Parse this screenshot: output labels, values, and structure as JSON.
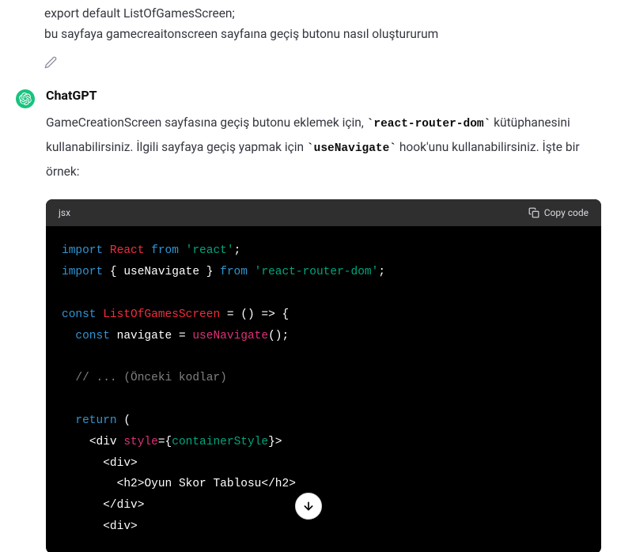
{
  "user": {
    "line1": "export default ListOfGamesScreen;",
    "line2": "bu sayfaya gamecreaitonscreen sayfaına geçiş butonu nasıl oluştururum"
  },
  "assistant": {
    "name": "ChatGPT",
    "p1_t1": "GameCreationScreen sayfasına geçiş butonu eklemek için, ",
    "p1_c1": "`react-router-dom`",
    "p1_t2": " kütüphanesini kullanabilirsiniz. İlgili sayfaya geçiş yapmak için ",
    "p1_c2": "`useNavigate`",
    "p1_t3": " hook'unu kullanabilirsiniz. İşte bir örnek:"
  },
  "codeblock": {
    "lang": "jsx",
    "copy_label": "Copy code",
    "lines": {
      "l1": {
        "import": "import",
        "sp1": " ",
        "react": "React",
        "sp2": " ",
        "from": "from",
        "sp3": " ",
        "str": "'react'",
        "semi": ";"
      },
      "l2": {
        "import": "import",
        "sp1": " ",
        "ob": "{ ",
        "uv": "useNavigate",
        "cb": " }",
        "sp2": " ",
        "from": "from",
        "sp3": " ",
        "str": "'react-router-dom'",
        "semi": ";"
      },
      "l4": {
        "const": "const",
        "sp1": " ",
        "name": "ListOfGamesScreen",
        "sp2": " ",
        "eq": "= () => {"
      },
      "l5": {
        "indent": "  ",
        "const": "const",
        "sp1": " ",
        "nav": "navigate",
        "sp2": " ",
        "eq": "= ",
        "useNav": "useNavigate",
        "call": "();"
      },
      "l7": {
        "indent": "  ",
        "cmt": "// ... (Önceki kodlar)"
      },
      "l9": {
        "indent": "  ",
        "ret": "return",
        "sp1": " ",
        "open": "("
      },
      "l10": {
        "indent": "    ",
        "lt": "<",
        "tag": "div",
        "sp1": " ",
        "attr": "style",
        "eq": "=",
        "ob": "{",
        "val": "containerStyle",
        "cb": "}",
        "gt": ">"
      },
      "l11": {
        "indent": "      ",
        "lt": "<",
        "tag": "div",
        "gt": ">"
      },
      "l12": {
        "indent": "        ",
        "lt": "<",
        "tag": "h2",
        "gt": ">",
        "txt": "Oyun Skor Tablosu",
        "lt2": "</",
        "tag2": "h2",
        "gt2": ">"
      },
      "l13": {
        "indent": "      ",
        "lt": "</",
        "tag": "div",
        "gt": ">"
      },
      "l14": {
        "indent": "      ",
        "lt": "<",
        "tag": "div",
        "gt": ">"
      }
    }
  }
}
